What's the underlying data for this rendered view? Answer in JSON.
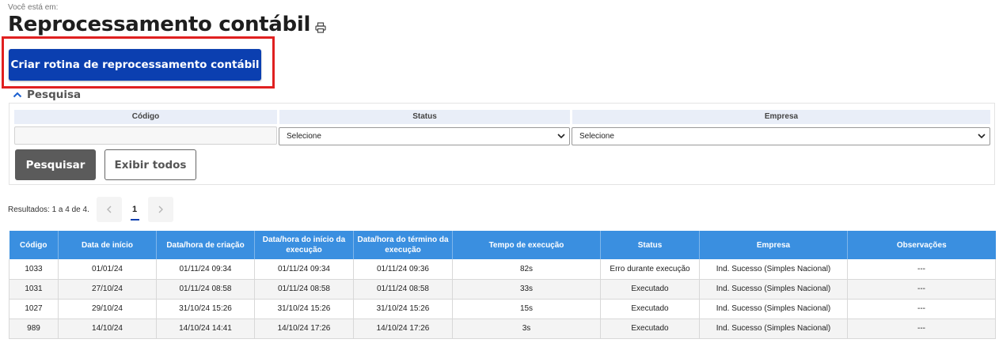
{
  "breadcrumb": "Você está em:",
  "page": {
    "title": "Reprocessamento contábil",
    "print_icon": "printer-icon"
  },
  "create_button": "Criar rotina de reprocessamento contábil",
  "search": {
    "toggle_label": "Pesquisa",
    "toggle_icon": "chevron-up-icon",
    "fields": {
      "code_label": "Código",
      "code_value": "",
      "status_label": "Status",
      "status_selected": "Selecione",
      "company_label": "Empresa",
      "company_selected": "Selecione"
    },
    "search_button": "Pesquisar",
    "show_all_button": "Exibir todos"
  },
  "results": {
    "summary": "Resultados: 1 a 4 de 4.",
    "pager": {
      "prev_icon": "chevron-left-icon",
      "current_page": "1",
      "next_icon": "chevron-right-icon"
    }
  },
  "table": {
    "columns": [
      "Código",
      "Data de início",
      "Data/hora de criação",
      "Data/hora do início da execução",
      "Data/hora do término da execução",
      "Tempo de execução",
      "Status",
      "Empresa",
      "Observações"
    ],
    "rows": [
      [
        "1033",
        "01/01/24",
        "01/11/24 09:34",
        "01/11/24 09:34",
        "01/11/24 09:36",
        "82s",
        "Erro durante execução",
        "Ind. Sucesso (Simples Nacional)",
        "---"
      ],
      [
        "1031",
        "27/10/24",
        "01/11/24 08:58",
        "01/11/24 08:58",
        "01/11/24 08:58",
        "33s",
        "Executado",
        "Ind. Sucesso (Simples Nacional)",
        "---"
      ],
      [
        "1027",
        "29/10/24",
        "31/10/24 15:26",
        "31/10/24 15:26",
        "31/10/24 15:26",
        "15s",
        "Executado",
        "Ind. Sucesso (Simples Nacional)",
        "---"
      ],
      [
        "989",
        "14/10/24",
        "14/10/24 14:41",
        "14/10/24 17:26",
        "14/10/24 17:26",
        "3s",
        "Executado",
        "Ind. Sucesso (Simples Nacional)",
        "---"
      ]
    ]
  },
  "colors": {
    "primary_button": "#0b3fb0",
    "table_header": "#3a8fe0",
    "highlight": "#e02020",
    "search_button": "#5b5b5b"
  }
}
